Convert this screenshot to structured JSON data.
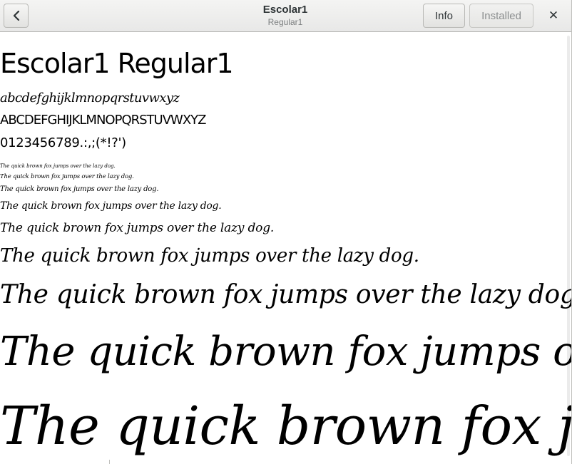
{
  "header": {
    "title": "Escolar1",
    "subtitle": "Regular1",
    "info_label": "Info",
    "installed_label": "Installed",
    "close_glyph": "✕",
    "back_icon": "chevron-left-icon",
    "close_icon": "close-icon"
  },
  "preview": {
    "font_name": "Escolar1 Regular1",
    "lowercase": "abcdefghijklmnopqrstuvwxyz",
    "uppercase": "ABCDEFGHIJKLMNOPQRSTUVWXYZ",
    "digits": "0123456789.:,;(*!?')",
    "pangram": "The quick brown fox jumps over the lazy dog."
  }
}
